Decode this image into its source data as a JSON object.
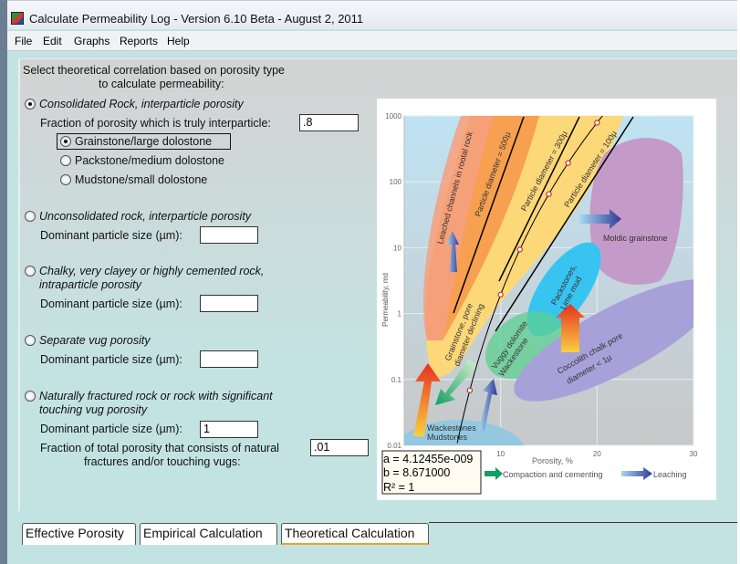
{
  "window": {
    "title": "Calculate Permeability Log - Version 6.10 Beta - August 2, 2011"
  },
  "menu": [
    "File",
    "Edit",
    "Graphs",
    "Reports",
    "Help"
  ],
  "form": {
    "heading_line1": "Select theoretical correlation based on porosity type",
    "heading_line2": "to calculate permeability:",
    "options": [
      {
        "label": "Consolidated Rock, interparticle porosity",
        "selected": true
      },
      {
        "label": "Unconsolidated rock, interparticle porosity",
        "selected": false
      },
      {
        "label_line1": "Chalky, very clayey or highly cemented rock,",
        "label_line2": "intraparticle porosity",
        "selected": false
      },
      {
        "label": "Separate vug porosity",
        "selected": false
      },
      {
        "label_line1": "Naturally fractured rock or rock with significant",
        "label_line2": "touching vug porosity",
        "selected": false
      }
    ],
    "fraction_interparticle_label": "Fraction of porosity which is truly interparticle:",
    "fraction_interparticle_value": ".8",
    "subtypes": [
      {
        "label": "Grainstone/large dolostone",
        "selected": true
      },
      {
        "label": "Packstone/medium dolostone",
        "selected": false
      },
      {
        "label": "Mudstone/small dolostone",
        "selected": false
      }
    ],
    "particle_size_label": "Dominant particle size (µm):",
    "unconsolidated_size": "",
    "chalky_size": "",
    "vug_size": "",
    "fractured_size": "1",
    "fracture_fraction_label_line1": "Fraction of total porosity that consists of natural",
    "fracture_fraction_label_line2": "fractures and/or touching vugs:",
    "fracture_fraction_value": ".01"
  },
  "chart_data": {
    "type": "scatter",
    "xlabel": "Porosity, %",
    "ylabel": "Permeability, md",
    "xlim": [
      0,
      30
    ],
    "ylim": [
      0.01,
      1000
    ],
    "yscale": "log",
    "xticks": [
      "10",
      "20",
      "30"
    ],
    "yticks": [
      "0.01",
      "0.1",
      "1",
      "10",
      "100",
      "1000"
    ],
    "region_labels": {
      "leached": "Leached channels in rootal rock",
      "p500": "Particle diameter = 500µ",
      "p300": "Particle diameter = 300µ",
      "p100": "Particle diameter = 100µ",
      "moldic": "Moldic grainstone",
      "pack1": "Packstones,",
      "pack2": "Lime mud",
      "grain1": "Grainstone, pore",
      "grain2": "diameter declining",
      "vuggy1": "Vuggy dolomite",
      "vuggy2": "Wackestone",
      "cocco1": "Coccolith chalk pore",
      "cocco2": "diameter < 1µ",
      "wack1": "Wackestones",
      "wack2": "Mudstones"
    },
    "legend": {
      "compaction": "Compaction and cementing",
      "leaching": "Leaching"
    },
    "fit": {
      "a_text": "a = 4.12455e-009",
      "b_text": "b = 8.671000",
      "r2_text": "R² = 1",
      "a": 4.12455e-09,
      "b": 8.671
    },
    "points_porosity": [
      6.8,
      10,
      12,
      15,
      17,
      20
    ],
    "colors": {
      "fit": "#000000",
      "marker": "#c03030"
    }
  },
  "tabs": [
    {
      "label": "Effective Porosity",
      "active": false
    },
    {
      "label": "Empirical Calculation",
      "active": false
    },
    {
      "label": "Theoretical Calculation",
      "active": true
    }
  ]
}
